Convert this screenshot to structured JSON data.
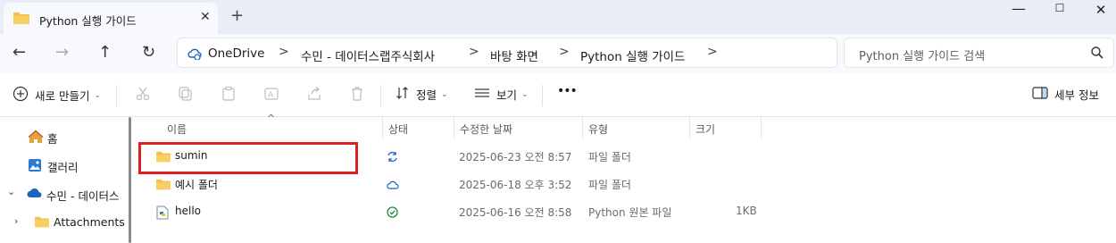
{
  "window": {
    "tab_title": "Python 실행 가이드",
    "tab_close": "✕",
    "new_tab": "+",
    "minimize": "—",
    "maximize": "☐",
    "close": "✕"
  },
  "nav": {
    "back": "←",
    "forward": "→",
    "up": "↑",
    "refresh": "↻"
  },
  "breadcrumb": {
    "items": [
      "OneDrive",
      "수민 - 데이터스랩주식회사",
      "바탕 화면",
      "Python 실행 가이드"
    ],
    "separator": ">"
  },
  "search": {
    "placeholder": "Python 실행 가이드 검색"
  },
  "toolbar": {
    "new_label": "새로 만들기",
    "sort_label": "정렬",
    "view_label": "보기",
    "more_label": "•••",
    "details_label": "세부 정보"
  },
  "sidebar": {
    "items": [
      {
        "label": "홈",
        "icon": "home-icon"
      },
      {
        "label": "갤러리",
        "icon": "gallery-icon"
      },
      {
        "label": "수민 - 데이터스",
        "icon": "onedrive-cloud-icon"
      },
      {
        "label": "Attachments",
        "icon": "folder-icon"
      }
    ]
  },
  "columns": {
    "name": "이름",
    "status": "상태",
    "modified": "수정한 날짜",
    "type": "유형",
    "size": "크기"
  },
  "files": [
    {
      "name": "sumin",
      "status": "sync-icon",
      "modified": "2025-06-23 오전 8:57",
      "type": "파일 폴더",
      "size": ""
    },
    {
      "name": "예시 폴더",
      "status": "cloud-icon",
      "modified": "2025-06-18 오후 3:52",
      "type": "파일 폴더",
      "size": ""
    },
    {
      "name": "hello",
      "status": "check-circle-icon",
      "modified": "2025-06-16 오전 8:58",
      "type": "Python 원본 파일",
      "size": "1KB"
    }
  ],
  "colors": {
    "accent": "#0067c0",
    "folder": "#f3c04e",
    "highlight": "#e02020",
    "status_green": "#1e8a3a"
  }
}
